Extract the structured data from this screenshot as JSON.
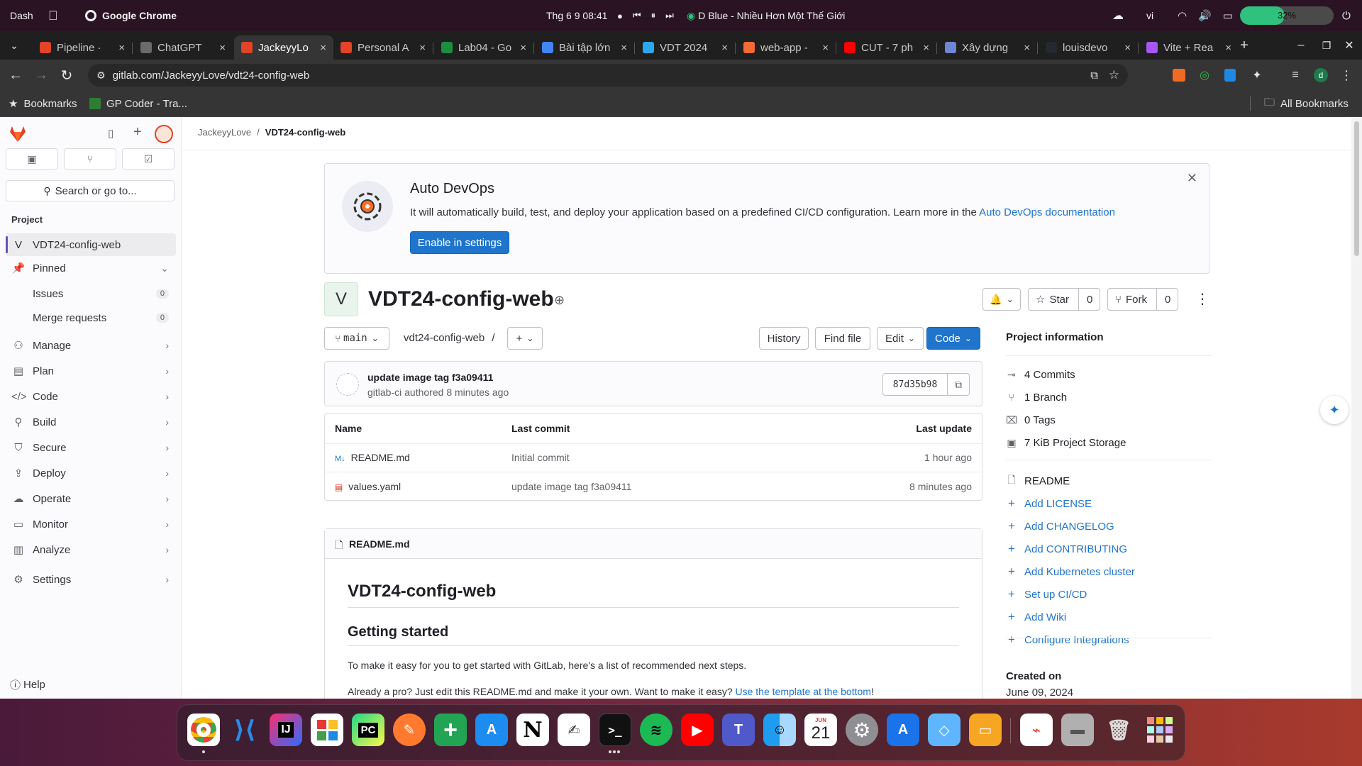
{
  "os": {
    "activities": "Dash",
    "app_name": "Google Chrome",
    "datetime": "Thg 6 9  08:41",
    "media_title": "D Blue - Nhiều Hơn Một Thế Giới",
    "lang": "vi",
    "battery": "32%",
    "battery_level": 0.48
  },
  "browser": {
    "tabs": [
      {
        "label": "Pipeline ·",
        "color": "#e24329"
      },
      {
        "label": "ChatGPT",
        "color": "#6b6b6b"
      },
      {
        "label": "JackeyyLo",
        "color": "#e24329",
        "active": true
      },
      {
        "label": "Personal A",
        "color": "#e24329"
      },
      {
        "label": "Lab04 - Go",
        "color": "#1e8e3e"
      },
      {
        "label": "Bài tập lớn",
        "color": "#4285f4"
      },
      {
        "label": "VDT 2024",
        "color": "#29a9eb"
      },
      {
        "label": "web-app -",
        "color": "#f46a35"
      },
      {
        "label": "CUT - 7 ph",
        "color": "#ff0000"
      },
      {
        "label": "Xây dựng",
        "color": "#6f86d6"
      },
      {
        "label": "louisdevo",
        "color": "#24292f"
      },
      {
        "label": "Vite + Rea",
        "color": "#a855f7"
      }
    ],
    "close_glyph": "×",
    "newtab_glyph": "+",
    "url": "gitlab.com/JackeyyLove/vdt24-config-web",
    "bookmarks_label": "Bookmarks",
    "bookmark_item": "GP Coder - Tra...",
    "all_bookmarks": "All Bookmarks",
    "profile_initial": "d"
  },
  "sidebar": {
    "search_placeholder": "Search or go to...",
    "section": "Project",
    "project_initial": "V",
    "project_name": "VDT24-config-web",
    "pinned": "Pinned",
    "issues": {
      "label": "Issues",
      "count": "0"
    },
    "merge_requests": {
      "label": "Merge requests",
      "count": "0"
    },
    "nav": [
      {
        "label": "Manage",
        "icon": "manage-icon",
        "glyph": "⚇"
      },
      {
        "label": "Plan",
        "icon": "plan-icon",
        "glyph": "▤"
      },
      {
        "label": "Code",
        "icon": "code-icon",
        "glyph": "</>"
      },
      {
        "label": "Build",
        "icon": "rocket-icon",
        "glyph": "⚲"
      },
      {
        "label": "Secure",
        "icon": "shield-icon",
        "glyph": "⛉"
      },
      {
        "label": "Deploy",
        "icon": "deploy-icon",
        "glyph": "⇪"
      },
      {
        "label": "Operate",
        "icon": "cloud-icon",
        "glyph": "☁"
      },
      {
        "label": "Monitor",
        "icon": "monitor-icon",
        "glyph": "▭"
      },
      {
        "label": "Analyze",
        "icon": "chart-icon",
        "glyph": "▥"
      }
    ],
    "settings": "Settings",
    "help": "Help"
  },
  "breadcrumb": {
    "owner": "JackeyyLove",
    "sep": "/",
    "project": "VDT24-config-web"
  },
  "devops": {
    "title": "Auto DevOps",
    "text": "It will automatically build, test, and deploy your application based on a predefined CI/CD configuration. Learn more in the ",
    "link": "Auto DevOps documentation",
    "button": "Enable in settings"
  },
  "project": {
    "initial": "V",
    "title": "VDT24-config-web",
    "star_label": "Star",
    "star_count": "0",
    "fork_label": "Fork",
    "fork_count": "0"
  },
  "repo": {
    "branch": "main",
    "path": "vdt24-config-web",
    "path_sep": "/",
    "history": "History",
    "find_file": "Find file",
    "edit": "Edit",
    "code": "Code"
  },
  "commit": {
    "message": "update image tag f3a09411",
    "author": "gitlab-ci",
    "authored": "authored",
    "time": "8 minutes ago",
    "sha": "87d35b98"
  },
  "files": {
    "headers": [
      "Name",
      "Last commit",
      "Last update"
    ],
    "rows": [
      {
        "name": "README.md",
        "commit": "Initial commit",
        "updated": "1 hour ago",
        "icon": "markdown-icon"
      },
      {
        "name": "values.yaml",
        "commit": "update image tag f3a09411",
        "updated": "8 minutes ago",
        "icon": "yaml-icon"
      }
    ]
  },
  "readme": {
    "filename": "README.md",
    "h1": "VDT24-config-web",
    "h2": "Getting started",
    "p1": "To make it easy for you to get started with GitLab, here's a list of recommended next steps.",
    "p2": "Already a pro? Just edit this README.md and make it your own. Want to make it easy? ",
    "p2_link": "Use the template at the bottom",
    "p2_end": "!"
  },
  "project_info": {
    "title": "Project information",
    "stats": [
      {
        "label": "4 Commits",
        "icon": "commit-icon",
        "glyph": "⊸"
      },
      {
        "label": "1 Branch",
        "icon": "branch-icon",
        "glyph": "⑂"
      },
      {
        "label": "0 Tags",
        "icon": "tag-icon",
        "glyph": "⌧"
      },
      {
        "label": "7 KiB Project Storage",
        "icon": "storage-icon",
        "glyph": "▣"
      }
    ],
    "readme": "README",
    "actions": [
      "Add LICENSE",
      "Add CHANGELOG",
      "Add CONTRIBUTING",
      "Add Kubernetes cluster",
      "Set up CI/CD",
      "Add Wiki",
      "Configure Integrations"
    ],
    "created_label": "Created on",
    "created_date": "June 09, 2024"
  },
  "dock": {
    "calendar_month": "JUN",
    "calendar_day": "21"
  }
}
